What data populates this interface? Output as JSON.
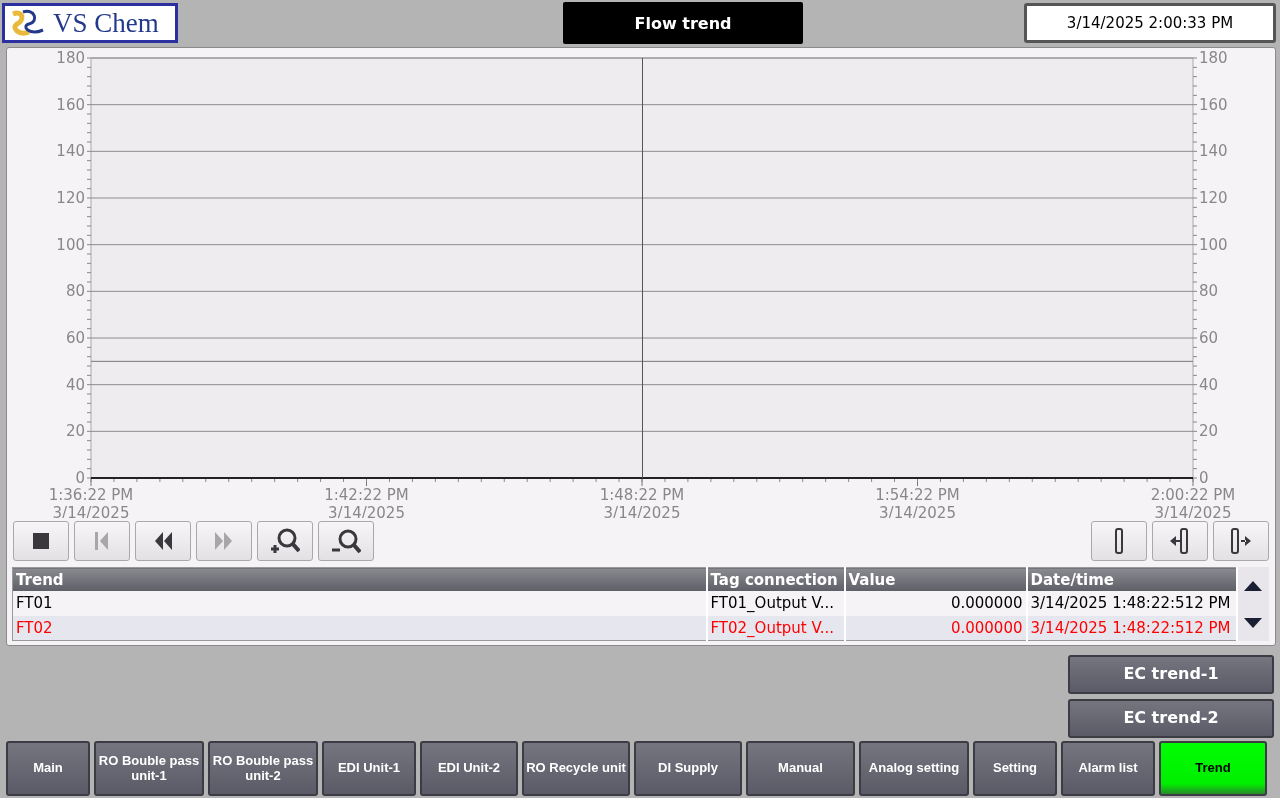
{
  "header": {
    "logo_text": "VS Chem",
    "title": "Flow trend",
    "clock": "3/14/2025 2:00:33 PM"
  },
  "trend_view": {
    "chart_data": {
      "type": "line",
      "ylim": [
        0,
        180
      ],
      "yticks": [
        0,
        20,
        40,
        60,
        80,
        100,
        120,
        140,
        160,
        180
      ],
      "categories": [
        "1:36:22 PM\n3/14/2025",
        "1:42:22 PM\n3/14/2025",
        "1:48:22 PM\n3/14/2025",
        "1:54:22 PM\n3/14/2025",
        "2:00:22 PM\n3/14/2025"
      ],
      "grid": true,
      "ref_lines": [
        {
          "axis": "y",
          "value": 50
        }
      ]
    },
    "right_axis_labels": [
      "180",
      "160",
      "140",
      "120",
      "100",
      "80",
      "60",
      "40",
      "20",
      "0"
    ],
    "toolbar_left": [
      {
        "kind": "stop",
        "disabled": false
      },
      {
        "kind": "first",
        "disabled": true
      },
      {
        "kind": "back",
        "disabled": false
      },
      {
        "kind": "forward",
        "disabled": true
      },
      {
        "kind": "zoom-in",
        "disabled": false
      },
      {
        "kind": "zoom-out",
        "disabled": false
      }
    ],
    "toolbar_right": [
      {
        "kind": "ruler"
      },
      {
        "kind": "ruler-left"
      },
      {
        "kind": "ruler-right"
      }
    ],
    "table": {
      "columns": [
        "Trend",
        "Tag connection",
        "Value",
        "Date/time"
      ],
      "rows": [
        {
          "trend": "FT01",
          "tag": "FT01_Output V...",
          "value": "0.000000",
          "datetime": "3/14/2025 1:48:22:512 PM",
          "color": "#000000",
          "selected": false
        },
        {
          "trend": "FT02",
          "tag": "FT02_Output V...",
          "value": "0.000000",
          "datetime": "3/14/2025 1:48:22:512 PM",
          "color": "#ff0000",
          "selected": true
        }
      ]
    }
  },
  "side_buttons": [
    "EC trend-1",
    "EC trend-2"
  ],
  "nav": [
    {
      "label": "Main",
      "selected": false
    },
    {
      "label": "RO Bouble pass\nunit-1",
      "selected": false
    },
    {
      "label": "RO Bouble pass\nunit-2",
      "selected": false
    },
    {
      "label": "EDI Unit-1",
      "selected": false
    },
    {
      "label": "EDI Unit-2",
      "selected": false
    },
    {
      "label": "RO Recycle unit",
      "selected": false
    },
    {
      "label": "DI Supply",
      "selected": false
    },
    {
      "label": "Manual",
      "selected": false
    },
    {
      "label": "Analog setting",
      "selected": false
    },
    {
      "label": "Setting",
      "selected": false
    },
    {
      "label": "Alarm list",
      "selected": false
    },
    {
      "label": "Trend",
      "selected": true
    }
  ]
}
